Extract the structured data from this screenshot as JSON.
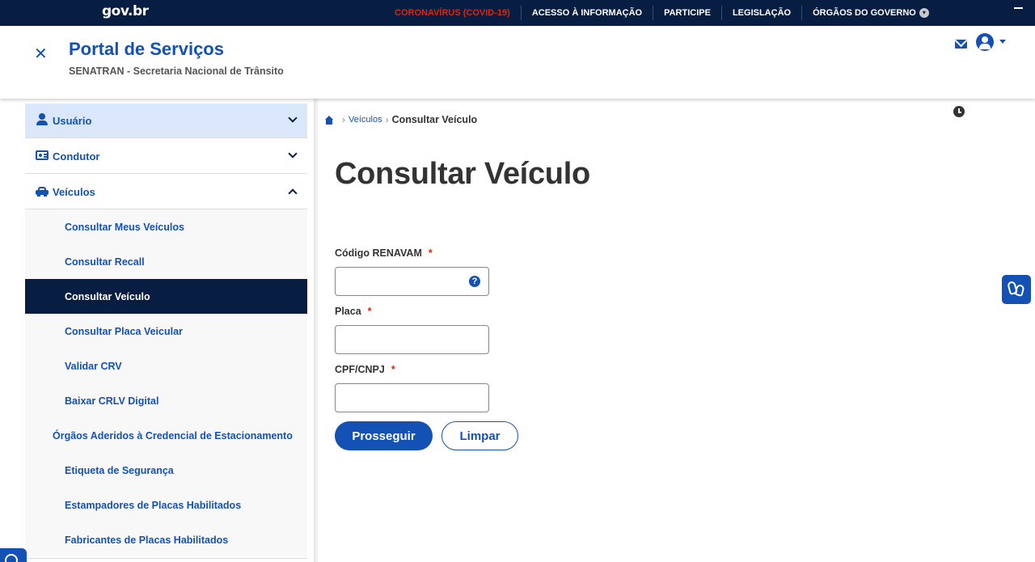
{
  "govbar": {
    "logo": "gov.br",
    "links": [
      "CORONAVÍRUS (COVID-19)",
      "ACESSO À INFORMAÇÃO",
      "PARTICIPE",
      "LEGISLAÇÃO",
      "ÓRGÃOS DO GOVERNO"
    ]
  },
  "header": {
    "title": "Portal de Serviços",
    "subtitle": "SENATRAN - Secretaria Nacional de Trânsito"
  },
  "sidebar": {
    "usuario": "Usuário",
    "condutor": "Condutor",
    "veiculos": "Veículos",
    "subitems": [
      "Consultar Meus Veículos",
      "Consultar Recall",
      "Consultar Veículo",
      "Consultar Placa Veicular",
      "Validar CRV",
      "Baixar CRLV Digital",
      "Órgãos Aderidos à Credencial de Estacionamento",
      "Etiqueta de Segurança",
      "Estampadores de Placas Habilitados",
      "Fabricantes de Placas Habilitados"
    ]
  },
  "breadcrumb": {
    "link": "Veículos",
    "current": "Consultar Veículo"
  },
  "main": {
    "title": "Consultar Veículo",
    "fields": [
      {
        "label": "Código RENAVAM",
        "required": "*",
        "value": ""
      },
      {
        "label": "Placa",
        "required": "*",
        "value": ""
      },
      {
        "label": "CPF/CNPJ",
        "required": "*",
        "value": ""
      }
    ],
    "help_glyph": "?",
    "submit_label": "Prosseguir",
    "clear_label": "Limpar"
  },
  "colors": {
    "brand_blue": "#1351b4",
    "navy": "#071d41",
    "covid_red": "#e52207",
    "active_bg": "#071d41",
    "highlight_bg": "#dbe8fb"
  },
  "icons": [
    "close-icon",
    "mail-icon",
    "user-avatar-icon",
    "caret-down-icon",
    "user-icon",
    "id-card-icon",
    "car-icon",
    "chevron-down-icon",
    "chevron-up-icon",
    "home-icon",
    "clock-icon",
    "help-icon",
    "sign-language-icon",
    "accessibility-icon"
  ]
}
